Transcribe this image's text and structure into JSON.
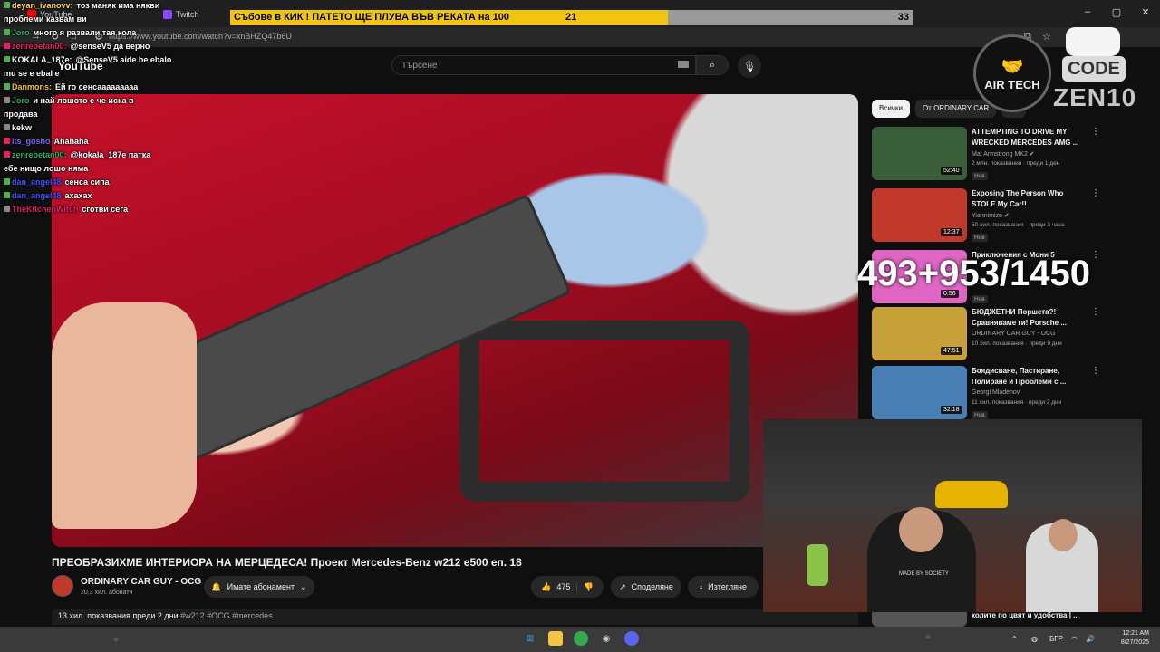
{
  "browser": {
    "tabs": [
      {
        "label": "YouTube",
        "color": "#ff0000"
      },
      {
        "label": "Twitch",
        "color": "#9146ff"
      }
    ],
    "url": "https://www.youtube.com/watch?v=xnBHZQ47b6U"
  },
  "youtube": {
    "logo": "YouTube",
    "search_placeholder": "Търсене",
    "video": {
      "title": "ПРЕОБРАЗИХМЕ ИНТЕРИОРА НА МЕРЦЕДЕСА! Проект Mercedes-Benz w212 e500 еп. 18",
      "channel": "ORDINARY CAR GUY - OCG",
      "subscribers": "20,3 хил. абонати",
      "subscribe_label": "Имате абонамент",
      "likes": "475",
      "share_label": "Споделяне",
      "download_label": "Изтегляне",
      "views_date": "13 хил. показвания  преди 2 дни",
      "tags": "#w212 #OCG #mercedes"
    },
    "chips": [
      "Всички",
      "От ORDINARY CAR",
      "Мо"
    ],
    "recommendations": [
      {
        "title": "ATTEMPTING TO DRIVE MY WRECKED MERCEDES AMG ...",
        "channel": "Mat Armstrong MK2 ✔",
        "meta": "2 млн. показвания · преди 1 ден",
        "badge": "Нов",
        "duration": "52:40",
        "thumb": "#3a5e3a"
      },
      {
        "title": "Exposing The Person Who STOLE My Car!!",
        "channel": "Yiannimize ✔",
        "meta": "50 хил. показвания · преди 3 часа",
        "badge": "Нов",
        "duration": "12:37",
        "thumb": "#c0392b"
      },
      {
        "title": "Приключения с Мони 5",
        "channel": "",
        "meta": "",
        "badge": "Нов",
        "duration": "0:56",
        "thumb": "#e066c4"
      },
      {
        "title": "БЮДЖЕТНИ Поршета?! Сравняваме ги! Porsche ...",
        "channel": "ORDINARY CAR GUY - OCG",
        "meta": "10 хил. показвания · преди 9 дни",
        "badge": "",
        "duration": "47:51",
        "thumb": "#c7a03a"
      },
      {
        "title": "Боядисване, Пастиране, Полиране и Проблеми с ...",
        "channel": "Georgi Mladenov",
        "meta": "11 хил. показвания · преди 2 дни",
        "badge": "Нов",
        "duration": "32:18",
        "thumb": "#4a7fb5"
      }
    ],
    "bottom_rec": "колите по цвят и удобства | ..."
  },
  "overlay": {
    "goal_text": "Събове в КИК ! ПАТЕТО ЩЕ ПЛУВА ВЪВ РЕКАТА на 100",
    "goal_current": "21",
    "goal_target": "33",
    "goal_fraction": 0.64,
    "counter": "493+953/1450",
    "sponsor": "AIR TECH",
    "code_label": "CODE",
    "code_value": "ZEN10",
    "webcam_shirt": "MADE BY SOCIETY"
  },
  "chat": [
    {
      "user": "deyan_ivanovv:",
      "text": "тоз маняк има някви",
      "color": "#ffd24a",
      "badge": "#4caf50"
    },
    {
      "user": "",
      "text": "проблеми казвам ви",
      "color": "#fff",
      "badge": ""
    },
    {
      "user": "Joro",
      "text": "много я развали тая кола",
      "color": "#27ae60",
      "badge": "#4caf50"
    },
    {
      "user": "zenrebetan00:",
      "text": "@senseV5 да верно",
      "color": "#e91e63",
      "badge": "#e91e63"
    },
    {
      "user": "KOKALA_187e:",
      "text": "@SenseV5 aide be ebalo",
      "color": "#fff",
      "badge": "#4caf50"
    },
    {
      "user": "",
      "text": "mu se e ebal e",
      "color": "#fff",
      "badge": ""
    },
    {
      "user": "Danmons:",
      "text": "Ей го сенсааааааааа",
      "color": "#f1c40f",
      "badge": "#4caf50"
    },
    {
      "user": "Joro",
      "text": "и най лошото е че иска в",
      "color": "#27ae60",
      "badge": "#888"
    },
    {
      "user": "",
      "text": "продава",
      "color": "#fff",
      "badge": ""
    },
    {
      "user": "",
      "text": "kekw",
      "color": "#fff",
      "badge": "#888"
    },
    {
      "user": "lts_gosho",
      "text": "Ahahaha",
      "color": "#7b5cff",
      "badge": "#e91e63"
    },
    {
      "user": "zenrebetan00:",
      "text": "@kokala_187e патка",
      "color": "#27ae60",
      "badge": "#e91e63"
    },
    {
      "user": "",
      "text": "ебе нищо лошо няма",
      "color": "#fff",
      "badge": ""
    },
    {
      "user": "dan_angel48",
      "text": "сенса сипа",
      "color": "#3f51ff",
      "badge": "#4caf50"
    },
    {
      "user": "dan_angel48",
      "text": "ахахах",
      "color": "#3f51ff",
      "badge": "#4caf50"
    },
    {
      "user": "TheKitchenWitch",
      "text": "сготви сега",
      "color": "#e91e63",
      "badge": "#888"
    }
  ],
  "taskbar": {
    "lang": "БГР",
    "time": "12:21 AM",
    "date": "8/27/2025"
  }
}
